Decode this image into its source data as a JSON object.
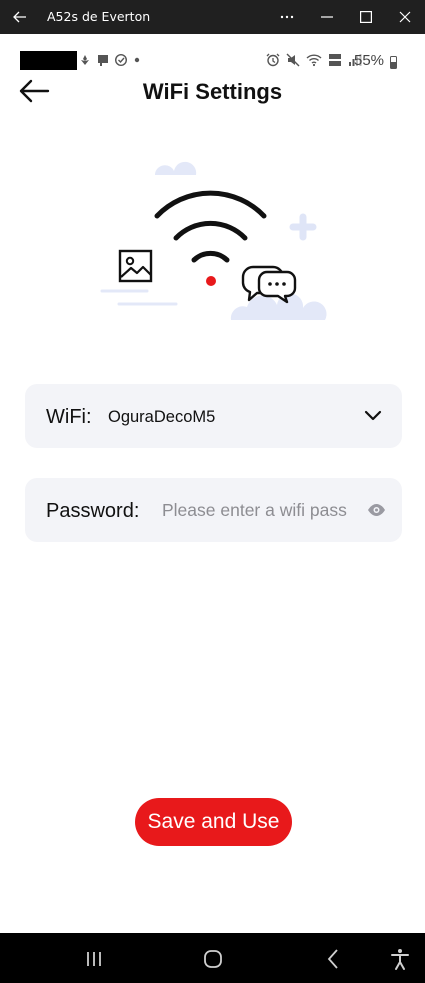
{
  "window": {
    "title": "A52s de Everton",
    "controls": [
      "back-icon",
      "more-icon",
      "minimize-icon",
      "maximize-icon",
      "close-icon"
    ]
  },
  "status_bar": {
    "battery_text": "55%",
    "right_icons": [
      "alarm-icon",
      "mute-icon",
      "wifi-icon",
      "volte-lte-icon",
      "signal-icon",
      "battery-icon"
    ],
    "left_icons": [
      "notification-icon",
      "notification-icon",
      "check-circle-icon",
      "dot-icon"
    ]
  },
  "header": {
    "title": "WiFi Settings",
    "back_icon": "back-arrow-icon"
  },
  "illustration": {
    "icons": [
      "wifi-signal-icon",
      "image-icon",
      "chat-bubbles-icon",
      "cloud-icon",
      "plus-icon"
    ],
    "colors": {
      "accent": "#e8191b",
      "line": "#111111",
      "decor": "#e3e8f8"
    }
  },
  "form": {
    "wifi": {
      "label": "WiFi:",
      "value": "OguraDecoM5",
      "icon": "chevron-down-icon"
    },
    "password": {
      "label": "Password:",
      "placeholder": "Please enter a wifi pass",
      "icon": "eye-icon"
    }
  },
  "actions": {
    "save_label": "Save and Use",
    "save_color": "#e8191b"
  },
  "nav_bar": {
    "icons": [
      "recents-icon",
      "home-icon",
      "back-icon",
      "accessibility-icon"
    ]
  }
}
